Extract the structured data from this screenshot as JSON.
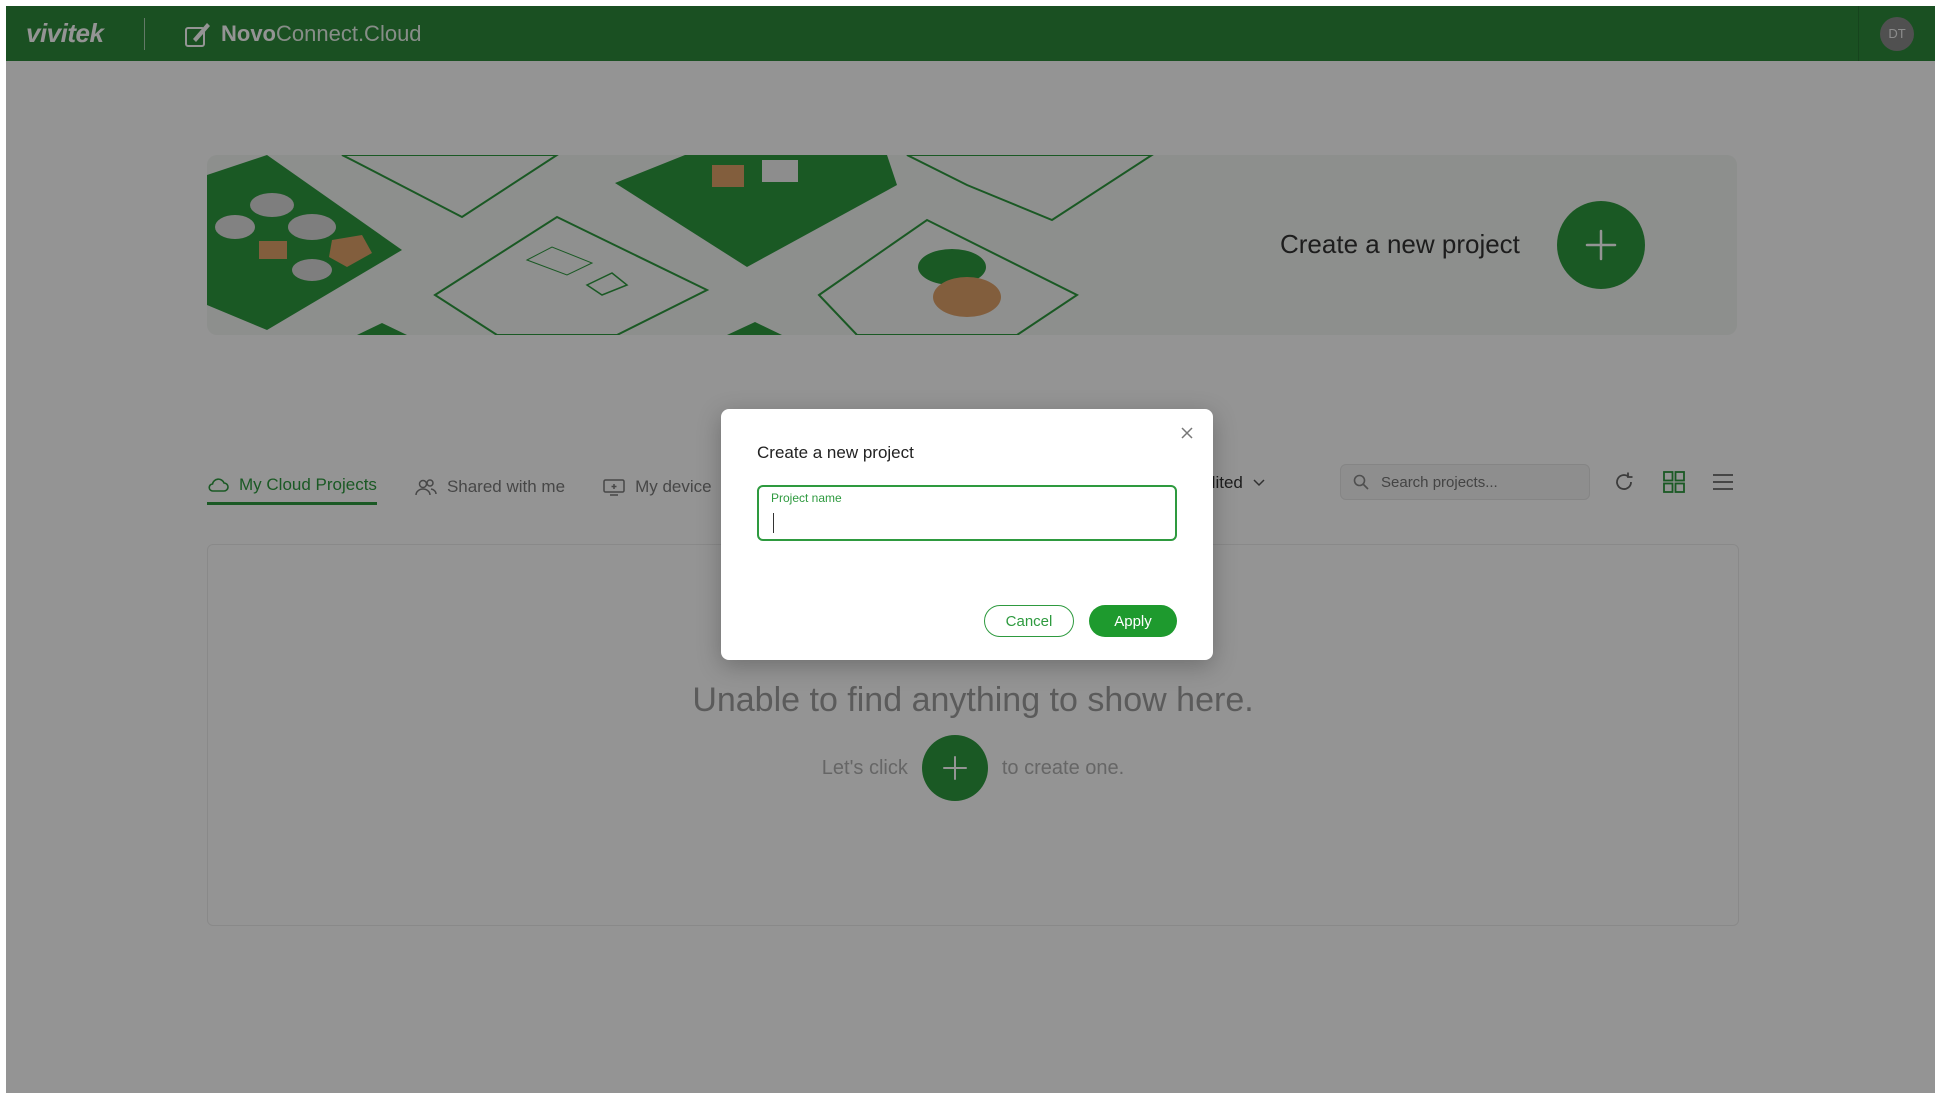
{
  "header": {
    "brand": "vivitek",
    "app_name_bold": "Novo",
    "app_name_light": "Connect.Cloud",
    "avatar_initials": "DT"
  },
  "hero": {
    "title": "Create a new project"
  },
  "tabs": [
    {
      "label": "My Cloud Projects",
      "icon": "cloud-icon",
      "active": true
    },
    {
      "label": "Shared with me",
      "icon": "users-icon",
      "active": false
    },
    {
      "label": "My device",
      "icon": "monitor-icon",
      "active": false
    }
  ],
  "toolbar": {
    "sort_label": "dited",
    "search_placeholder": "Search projects..."
  },
  "empty_state": {
    "title": "Unable to find anything to show here.",
    "hint_before": "Let's click",
    "hint_after": "to create one."
  },
  "modal": {
    "title": "Create a new project",
    "field_label": "Project name",
    "field_value": "",
    "cancel_label": "Cancel",
    "apply_label": "Apply"
  },
  "colors": {
    "brand_green": "#2e8a3c",
    "accent_green": "#2e9a3f",
    "overlay": "rgba(0,0,0,0.42)"
  }
}
